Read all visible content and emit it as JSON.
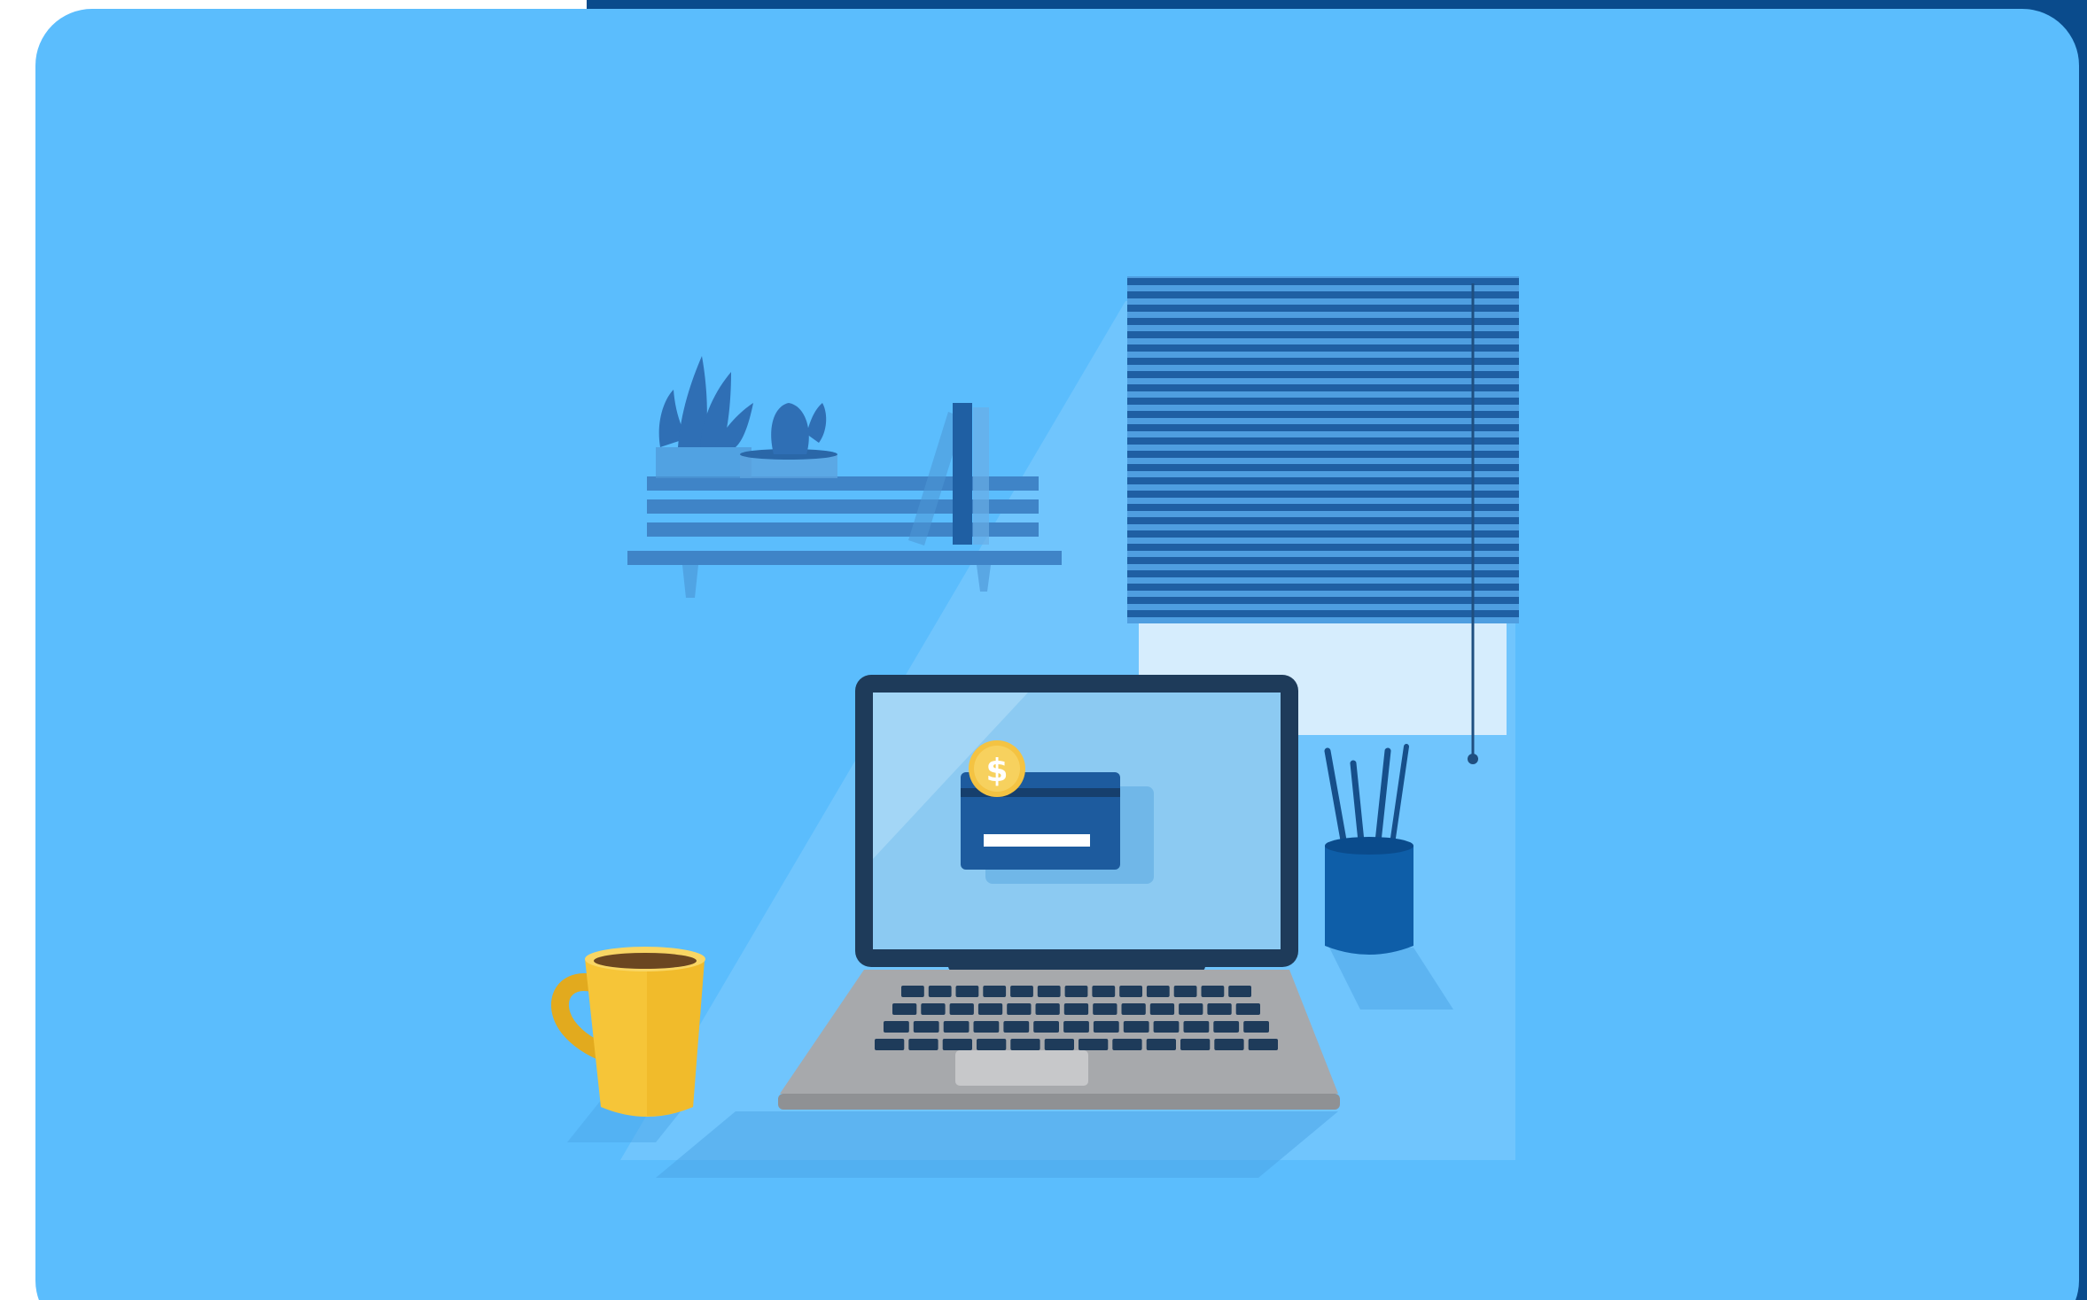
{
  "colors": {
    "page_background": "#ffffff",
    "accent_band": "#0a4b8c",
    "card_background": "#5bbdfd",
    "blinds": "#1f5fa3",
    "laptop_frame": "#1e3b5a",
    "laptop_screen": "#8ccaf2",
    "laptop_body": "#a7a9ac",
    "credit_card": "#1d5b9e",
    "coin": "#f4c342",
    "mug": "#f6c538",
    "pen_holder": "#0e5ea8",
    "shelf": "#3f84c7"
  },
  "illustration": {
    "coin_symbol": "$",
    "icons": [
      "plant-icon",
      "cactus-icon",
      "book-icon",
      "window-blinds-icon",
      "laptop-icon",
      "credit-card-icon",
      "coin-icon",
      "coffee-mug-icon",
      "pen-holder-icon"
    ]
  }
}
